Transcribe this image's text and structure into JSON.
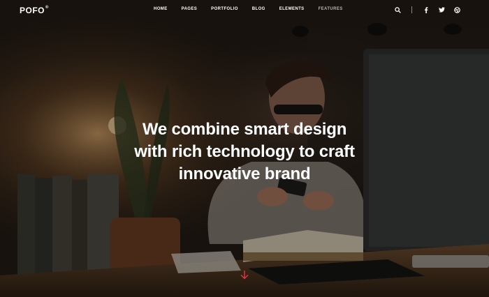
{
  "brand": {
    "logo": "POFO",
    "mark": "®"
  },
  "nav": {
    "items": [
      {
        "label": "HOME"
      },
      {
        "label": "PAGES"
      },
      {
        "label": "PORTFOLIO"
      },
      {
        "label": "BLOG"
      },
      {
        "label": "ELEMENTS"
      },
      {
        "label": "FEATURES"
      }
    ],
    "icons": [
      "search-icon",
      "facebook-icon",
      "twitter-icon",
      "dribbble-icon"
    ]
  },
  "hero": {
    "line1_regular": "We combine ",
    "line1_bold": "smart design",
    "line2_regular": "with rich technology to ",
    "line2_bold": "craft",
    "line3_bold": "innovative",
    "line3_regular": " brand"
  },
  "colors": {
    "accent": "#e8334a",
    "text": "#ffffff",
    "muted": "#b4b4b4"
  }
}
